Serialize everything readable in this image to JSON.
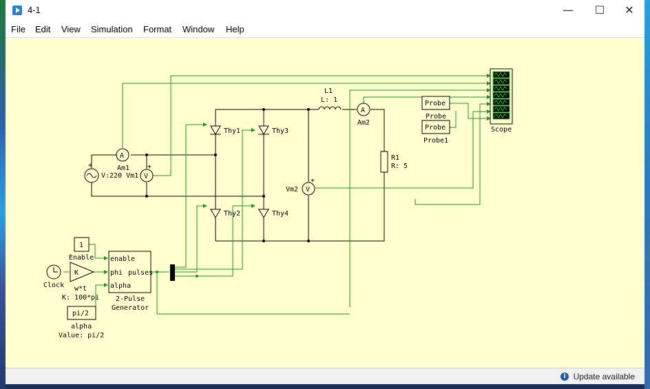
{
  "window": {
    "title": "4-1"
  },
  "menu": [
    "File",
    "Edit",
    "View",
    "Simulation",
    "Format",
    "Window",
    "Help"
  ],
  "status": {
    "text": "Update available"
  },
  "diagram": {
    "source_label": "V:220 Vm1",
    "am1": "Am1",
    "am2": "Am2",
    "vm2": "Vm2",
    "l1_name": "L1",
    "l1_value": "L: 1",
    "r1_name": "R1",
    "r1_value": "R: 5",
    "thy1": "Thy1",
    "thy2": "Thy2",
    "thy3": "Thy3",
    "thy4": "Thy4",
    "scope": "Scope",
    "probe_box": "Probe",
    "probe_label": "Probe",
    "probe1_label": "Probe1",
    "enable_const": "1",
    "enable_label": "Enable",
    "gain_symbol": "K",
    "gain_name": "w*t",
    "gain_value": "K: 100*pi",
    "clock_label": "Clock",
    "alpha_const": "pi/2",
    "alpha_label": "alpha",
    "alpha_value": "Value: pi/2",
    "gen_port_enable": "enable",
    "gen_port_phi": "phi",
    "gen_port_alpha": "alpha",
    "gen_port_pulses": "pulses",
    "gen_title1": "2-Pulse",
    "gen_title2": "Generator",
    "ammeter_symbol": "A",
    "voltmeter_symbol": "V"
  }
}
